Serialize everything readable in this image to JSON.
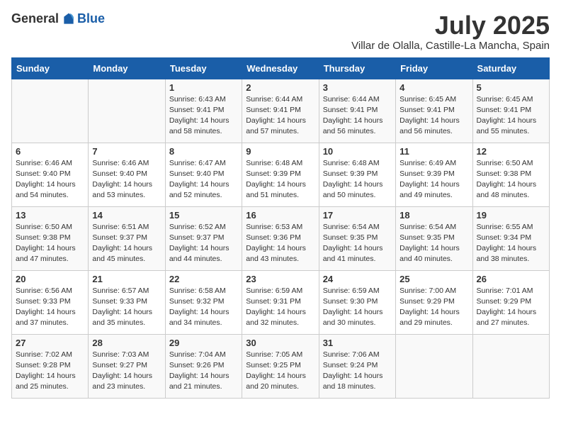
{
  "logo": {
    "general": "General",
    "blue": "Blue"
  },
  "header": {
    "month": "July 2025",
    "location": "Villar de Olalla, Castille-La Mancha, Spain"
  },
  "weekdays": [
    "Sunday",
    "Monday",
    "Tuesday",
    "Wednesday",
    "Thursday",
    "Friday",
    "Saturday"
  ],
  "weeks": [
    [
      {
        "day": "",
        "info": ""
      },
      {
        "day": "",
        "info": ""
      },
      {
        "day": "1",
        "info": "Sunrise: 6:43 AM\nSunset: 9:41 PM\nDaylight: 14 hours and 58 minutes."
      },
      {
        "day": "2",
        "info": "Sunrise: 6:44 AM\nSunset: 9:41 PM\nDaylight: 14 hours and 57 minutes."
      },
      {
        "day": "3",
        "info": "Sunrise: 6:44 AM\nSunset: 9:41 PM\nDaylight: 14 hours and 56 minutes."
      },
      {
        "day": "4",
        "info": "Sunrise: 6:45 AM\nSunset: 9:41 PM\nDaylight: 14 hours and 56 minutes."
      },
      {
        "day": "5",
        "info": "Sunrise: 6:45 AM\nSunset: 9:41 PM\nDaylight: 14 hours and 55 minutes."
      }
    ],
    [
      {
        "day": "6",
        "info": "Sunrise: 6:46 AM\nSunset: 9:40 PM\nDaylight: 14 hours and 54 minutes."
      },
      {
        "day": "7",
        "info": "Sunrise: 6:46 AM\nSunset: 9:40 PM\nDaylight: 14 hours and 53 minutes."
      },
      {
        "day": "8",
        "info": "Sunrise: 6:47 AM\nSunset: 9:40 PM\nDaylight: 14 hours and 52 minutes."
      },
      {
        "day": "9",
        "info": "Sunrise: 6:48 AM\nSunset: 9:39 PM\nDaylight: 14 hours and 51 minutes."
      },
      {
        "day": "10",
        "info": "Sunrise: 6:48 AM\nSunset: 9:39 PM\nDaylight: 14 hours and 50 minutes."
      },
      {
        "day": "11",
        "info": "Sunrise: 6:49 AM\nSunset: 9:39 PM\nDaylight: 14 hours and 49 minutes."
      },
      {
        "day": "12",
        "info": "Sunrise: 6:50 AM\nSunset: 9:38 PM\nDaylight: 14 hours and 48 minutes."
      }
    ],
    [
      {
        "day": "13",
        "info": "Sunrise: 6:50 AM\nSunset: 9:38 PM\nDaylight: 14 hours and 47 minutes."
      },
      {
        "day": "14",
        "info": "Sunrise: 6:51 AM\nSunset: 9:37 PM\nDaylight: 14 hours and 45 minutes."
      },
      {
        "day": "15",
        "info": "Sunrise: 6:52 AM\nSunset: 9:37 PM\nDaylight: 14 hours and 44 minutes."
      },
      {
        "day": "16",
        "info": "Sunrise: 6:53 AM\nSunset: 9:36 PM\nDaylight: 14 hours and 43 minutes."
      },
      {
        "day": "17",
        "info": "Sunrise: 6:54 AM\nSunset: 9:35 PM\nDaylight: 14 hours and 41 minutes."
      },
      {
        "day": "18",
        "info": "Sunrise: 6:54 AM\nSunset: 9:35 PM\nDaylight: 14 hours and 40 minutes."
      },
      {
        "day": "19",
        "info": "Sunrise: 6:55 AM\nSunset: 9:34 PM\nDaylight: 14 hours and 38 minutes."
      }
    ],
    [
      {
        "day": "20",
        "info": "Sunrise: 6:56 AM\nSunset: 9:33 PM\nDaylight: 14 hours and 37 minutes."
      },
      {
        "day": "21",
        "info": "Sunrise: 6:57 AM\nSunset: 9:33 PM\nDaylight: 14 hours and 35 minutes."
      },
      {
        "day": "22",
        "info": "Sunrise: 6:58 AM\nSunset: 9:32 PM\nDaylight: 14 hours and 34 minutes."
      },
      {
        "day": "23",
        "info": "Sunrise: 6:59 AM\nSunset: 9:31 PM\nDaylight: 14 hours and 32 minutes."
      },
      {
        "day": "24",
        "info": "Sunrise: 6:59 AM\nSunset: 9:30 PM\nDaylight: 14 hours and 30 minutes."
      },
      {
        "day": "25",
        "info": "Sunrise: 7:00 AM\nSunset: 9:29 PM\nDaylight: 14 hours and 29 minutes."
      },
      {
        "day": "26",
        "info": "Sunrise: 7:01 AM\nSunset: 9:29 PM\nDaylight: 14 hours and 27 minutes."
      }
    ],
    [
      {
        "day": "27",
        "info": "Sunrise: 7:02 AM\nSunset: 9:28 PM\nDaylight: 14 hours and 25 minutes."
      },
      {
        "day": "28",
        "info": "Sunrise: 7:03 AM\nSunset: 9:27 PM\nDaylight: 14 hours and 23 minutes."
      },
      {
        "day": "29",
        "info": "Sunrise: 7:04 AM\nSunset: 9:26 PM\nDaylight: 14 hours and 21 minutes."
      },
      {
        "day": "30",
        "info": "Sunrise: 7:05 AM\nSunset: 9:25 PM\nDaylight: 14 hours and 20 minutes."
      },
      {
        "day": "31",
        "info": "Sunrise: 7:06 AM\nSunset: 9:24 PM\nDaylight: 14 hours and 18 minutes."
      },
      {
        "day": "",
        "info": ""
      },
      {
        "day": "",
        "info": ""
      }
    ]
  ]
}
